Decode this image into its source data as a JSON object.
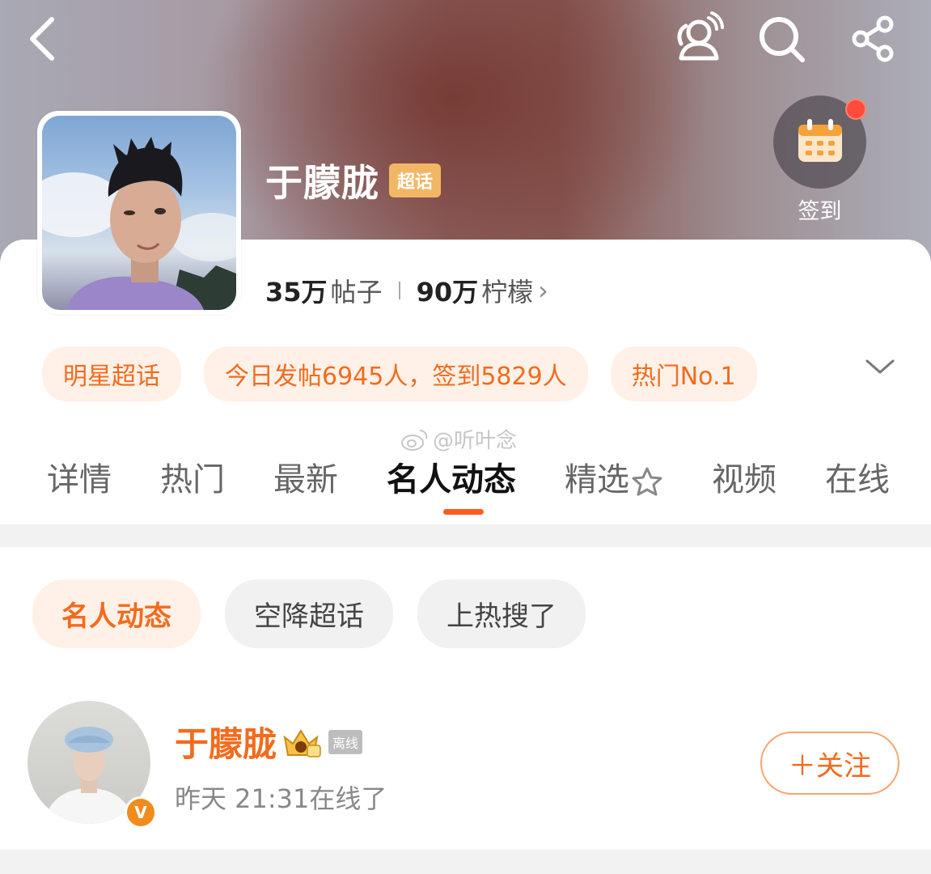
{
  "header": {
    "title": "于朦胧",
    "badge": "超话",
    "checkin_label": "签到"
  },
  "stats": {
    "posts_num": "35万",
    "posts_label": "帖子",
    "fans_num": "90万",
    "fans_label": "柠檬",
    "more": "›"
  },
  "pills": [
    "明星超话",
    "今日发帖6945人，签到5829人",
    "热门No.1"
  ],
  "watermark": "@听叶念",
  "tabs": [
    "详情",
    "热门",
    "最新",
    "名人动态",
    "精选",
    "视频",
    "在线"
  ],
  "active_tab": "名人动态",
  "filters": [
    "名人动态",
    "空降超话",
    "上热搜了"
  ],
  "user": {
    "name": "于朦胧",
    "offline_tag": "离线",
    "status": "昨天 21:31在线了",
    "follow_label": "＋关注",
    "verified": "V"
  },
  "colors": {
    "accent": "#f26b1d",
    "badge": "#f2b765"
  }
}
